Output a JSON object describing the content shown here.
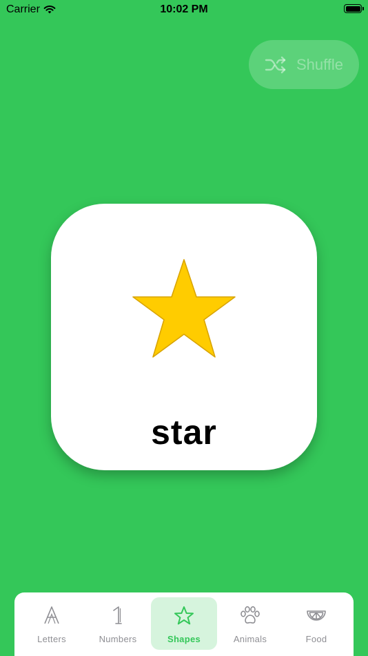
{
  "status_bar": {
    "carrier": "Carrier",
    "time": "10:02 PM"
  },
  "shuffle": {
    "label": "Shuffle",
    "icon": "shuffle-icon"
  },
  "card": {
    "word": "star",
    "image": "star-shape",
    "image_fill": "#ffcc00",
    "image_stroke": "#d9a400"
  },
  "tabs": [
    {
      "label": "Letters",
      "icon": "letter-a-icon",
      "active": false
    },
    {
      "label": "Numbers",
      "icon": "number-one-icon",
      "active": false
    },
    {
      "label": "Shapes",
      "icon": "star-icon",
      "active": true
    },
    {
      "label": "Animals",
      "icon": "paw-icon",
      "active": false
    },
    {
      "label": "Food",
      "icon": "citrus-slice-icon",
      "active": false
    }
  ],
  "colors": {
    "background": "#34c759",
    "accent": "#34c759",
    "active_tab_bg": "#d6f4dd",
    "inactive": "#8e8e93"
  }
}
